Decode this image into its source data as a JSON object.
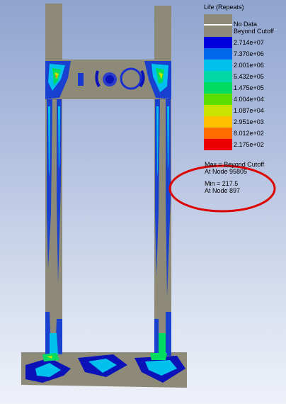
{
  "legend": {
    "title": "Life (Repeats)",
    "entries": [
      {
        "label": "No Data",
        "color": "#8e8a78",
        "line": true
      },
      {
        "label": "Beyond Cutoff",
        "color": "#8e8a78"
      },
      {
        "label": "2.714e+07",
        "color": "#0000dc"
      },
      {
        "label": "7.370e+06",
        "color": "#0068e8"
      },
      {
        "label": "2.001e+06",
        "color": "#00c0ee"
      },
      {
        "label": "5.432e+05",
        "color": "#00d8a8"
      },
      {
        "label": "1.475e+05",
        "color": "#00dc60"
      },
      {
        "label": "4.004e+04",
        "color": "#5cdc00"
      },
      {
        "label": "1.087e+04",
        "color": "#c8e400"
      },
      {
        "label": "2.951e+03",
        "color": "#ffc000"
      },
      {
        "label": "8.012e+02",
        "color": "#ff6c00"
      },
      {
        "label": "2.175e+02",
        "color": "#ee0000"
      }
    ],
    "max_label": "Max = Beyond Cutoff",
    "max_node": "At Node 95805",
    "min_label": "Min = 217.5",
    "min_node": "At Node 897"
  },
  "colors": {
    "structure": "#8e8a78",
    "highlight_ellipse": "#dd0000"
  }
}
